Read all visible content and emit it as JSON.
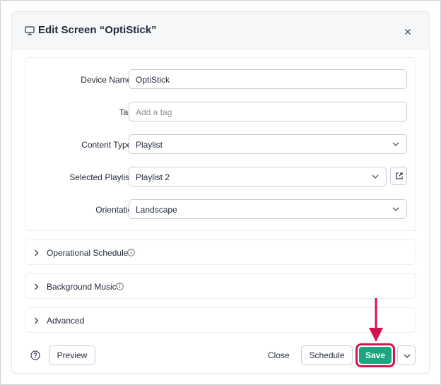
{
  "modal": {
    "title": "Edit Screen  “OptiStick”",
    "header_icon": "monitor-icon",
    "close_icon": "close-icon"
  },
  "form": {
    "device_name": {
      "label": "Device Name",
      "required_mark": "*",
      "value": "OptiStick"
    },
    "tags": {
      "label": "Tags",
      "placeholder": "Add a tag"
    },
    "content_type": {
      "label": "Content Type",
      "required_mark": "*",
      "value": "Playlist"
    },
    "selected_playlist": {
      "label": "Selected Playlist",
      "required_mark": "*",
      "value": "Playlist 2",
      "open_icon": "external-link-icon"
    },
    "orientation": {
      "label": "Orientation",
      "value": "Landscape"
    }
  },
  "sections": [
    {
      "label": "Operational Schedule",
      "has_info": true
    },
    {
      "label": "Background Music",
      "has_info": true
    },
    {
      "label": "Advanced",
      "has_info": false
    }
  ],
  "footer": {
    "help_icon": "help-icon",
    "preview_label": "Preview",
    "close_label": "Close",
    "schedule_label": "Schedule",
    "save_label": "Save",
    "more_icon": "chevron-down-icon"
  },
  "colors": {
    "accent": "#1aa67f",
    "annotation": "#d6134f",
    "required": "#e03131"
  }
}
